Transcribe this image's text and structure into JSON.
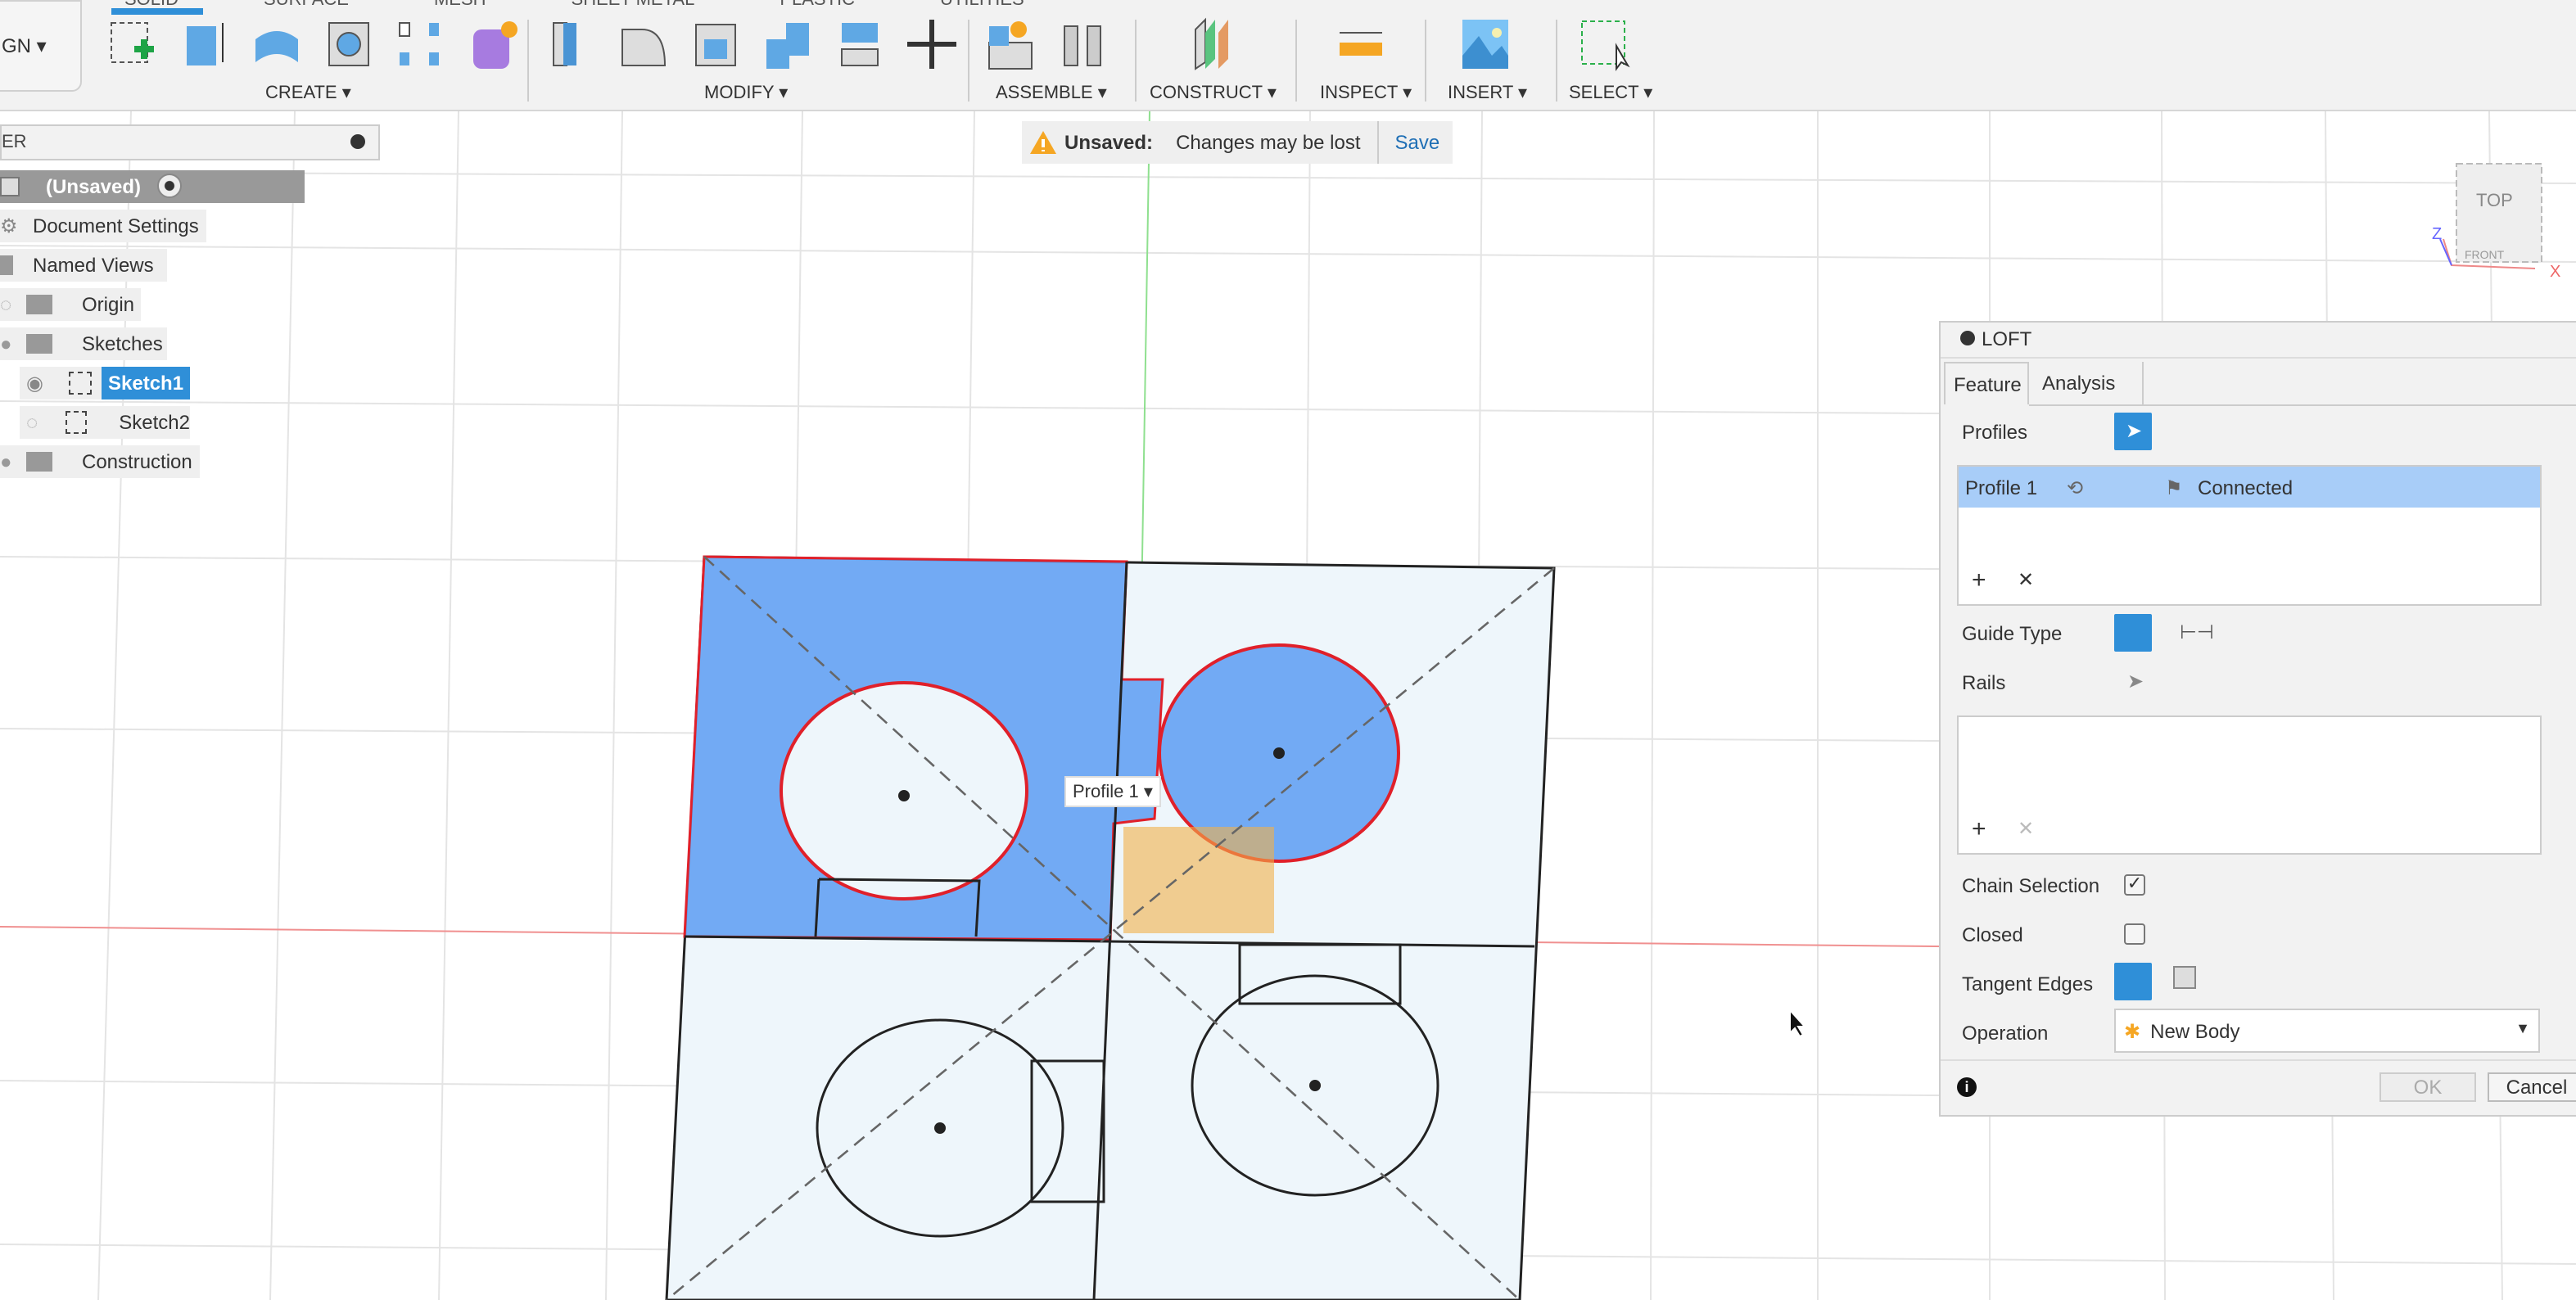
{
  "toolbar": {
    "workspace": "GN ▾",
    "tabs": [
      "SOLID",
      "SURFACE",
      "MESH",
      "SHEET METAL",
      "PLASTIC",
      "UTILITIES"
    ],
    "groups": {
      "create": "CREATE ▾",
      "modify": "MODIFY ▾",
      "assemble": "ASSEMBLE ▾",
      "construct": "CONSTRUCT ▾",
      "inspect": "INSPECT ▾",
      "insert": "INSERT ▾",
      "select": "SELECT ▾"
    }
  },
  "banner": {
    "title": "Unsaved:",
    "message": "Changes may be lost",
    "save": "Save"
  },
  "browser": {
    "title": "ER",
    "items": [
      {
        "label": "(Unsaved)"
      },
      {
        "label": "Document Settings"
      },
      {
        "label": "Named Views"
      },
      {
        "label": "Origin"
      },
      {
        "label": "Sketches"
      },
      {
        "label": "Sketch1"
      },
      {
        "label": "Sketch2"
      },
      {
        "label": "Construction"
      }
    ]
  },
  "viewcube": {
    "top": "TOP",
    "front": "FRONT",
    "z": "Z",
    "x": "X"
  },
  "canvas": {
    "profile_label": "Profile 1 ▾"
  },
  "loft": {
    "title": "LOFT",
    "tabs": [
      "Feature",
      "Analysis"
    ],
    "profiles_label": "Profiles",
    "profile_row": {
      "name": "Profile 1",
      "status": "Connected"
    },
    "guide_type_label": "Guide Type",
    "rails_label": "Rails",
    "chain_selection_label": "Chain Selection",
    "chain_selection": true,
    "closed_label": "Closed",
    "closed": false,
    "tangent_edges_label": "Tangent Edges",
    "operation_label": "Operation",
    "operation_value": "New Body",
    "add": "+",
    "remove": "✕",
    "ok": "OK",
    "cancel": "Cancel"
  },
  "colors": {
    "accent": "#2f8fd8",
    "profile_fill": "#5c9cf2",
    "sketch_red": "#e0202a"
  }
}
